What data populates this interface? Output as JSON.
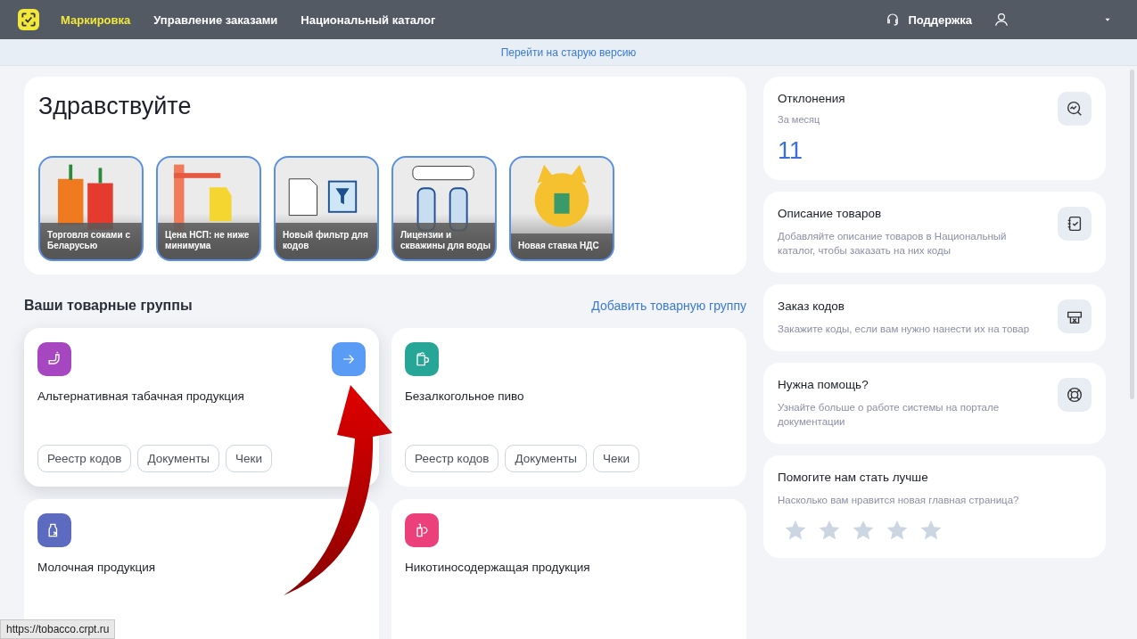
{
  "top_nav": {
    "items": [
      {
        "label": "Маркировка",
        "selected": true
      },
      {
        "label": "Управление заказами",
        "selected": false
      },
      {
        "label": "Национальный каталог",
        "selected": false
      }
    ],
    "support": "Поддержка"
  },
  "banner_link": "Перейти на старую версию",
  "greeting": {
    "title": "Здравствуйте",
    "stories": [
      {
        "caption": "Торговля соками с Беларусью"
      },
      {
        "caption": "Цена НСП: не ниже минимума"
      },
      {
        "caption": "Новый фильтр для кодов"
      },
      {
        "caption": "Лицензии и скважины для воды"
      },
      {
        "caption": "Новая ставка НДС"
      }
    ]
  },
  "product_groups": {
    "title": "Ваши товарные группы",
    "add_link": "Добавить товарную группу",
    "cards": [
      {
        "name": "Альтернативная табачная продукция",
        "color": "#a646c0",
        "hovered": true,
        "chips": [
          "Реестр кодов",
          "Документы",
          "Чеки"
        ]
      },
      {
        "name": "Безалкогольное пиво",
        "color": "#27a597",
        "hovered": false,
        "chips": [
          "Реестр кодов",
          "Документы",
          "Чеки"
        ]
      },
      {
        "name": "Молочная продукция",
        "color": "#5c6bc0",
        "hovered": false
      },
      {
        "name": "Никотиносодержащая продукция",
        "color": "#ec407a",
        "hovered": false
      }
    ]
  },
  "side_cards": [
    {
      "kind": "metric",
      "title": "Отклонения",
      "subtitle": "За месяц",
      "value": "11"
    },
    {
      "kind": "info",
      "title": "Описание товаров",
      "text": "Добавляйте описание товаров в Национальный каталог, чтобы заказать на них коды"
    },
    {
      "kind": "info",
      "title": "Заказ кодов",
      "text": "Закажите коды, если вам нужно нанести их на товар"
    },
    {
      "kind": "info",
      "title": "Нужна помощь?",
      "text": "Узнайте больше о работе системы на портале документации"
    },
    {
      "kind": "rating",
      "title": "Помогите нам стать лучше",
      "text": "Насколько вам нравится новая главная страница?",
      "stars": 0
    }
  ],
  "status_url": "https://tobacco.crpt.ru"
}
